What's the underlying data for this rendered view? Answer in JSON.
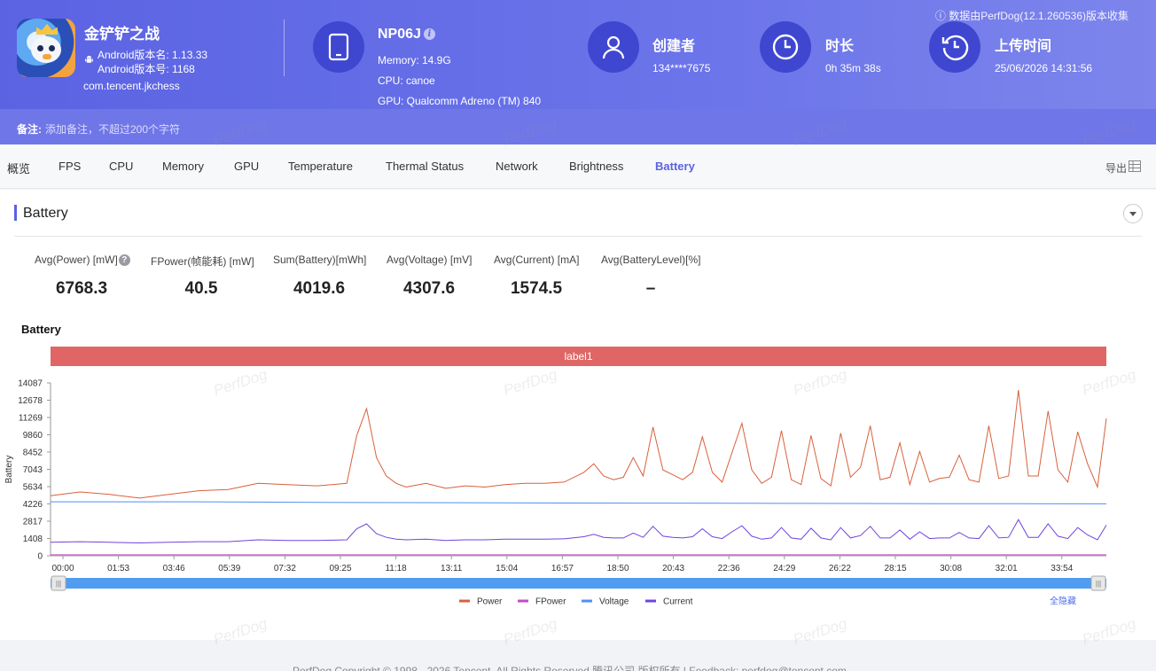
{
  "app": {
    "game_name": "金铲铲之战",
    "version_name": "Android版本名: 1.13.33",
    "version_code": "Android版本号: 1168",
    "package": "com.tencent.jkchess"
  },
  "device": {
    "name": "NP06J",
    "memory": "Memory: 14.9G",
    "cpu": "CPU: canoe",
    "gpu": "GPU: Qualcomm Adreno (TM) 840"
  },
  "creator": {
    "title": "创建者",
    "value": "134****7675"
  },
  "duration": {
    "title": "时长",
    "value": "0h 35m 38s"
  },
  "upload": {
    "title": "上传时间",
    "value": "25/06/2026 14:31:56"
  },
  "source_note": "数据由PerfDog(12.1.260536)版本收集",
  "notes": {
    "label": "备注:",
    "placeholder": "添加备注，不超过200个字符"
  },
  "tabs": [
    "概览",
    "FPS",
    "CPU",
    "Memory",
    "GPU",
    "Temperature",
    "Thermal Status",
    "Network",
    "Brightness",
    "Battery"
  ],
  "active_tab": "Battery",
  "export_label": "导出",
  "section_title": "Battery",
  "stats": [
    {
      "label": "Avg(Power) [mW]",
      "value": "6768.3"
    },
    {
      "label": "FPower(帧能耗) [mW]",
      "value": "40.5"
    },
    {
      "label": "Sum(Battery)[mWh]",
      "value": "4019.6"
    },
    {
      "label": "Avg(Voltage) [mV]",
      "value": "4307.6"
    },
    {
      "label": "Avg(Current) [mA]",
      "value": "1574.5"
    },
    {
      "label": "Avg(BatteryLevel)[%]",
      "value": "–"
    }
  ],
  "watermark_text": "PerfDog",
  "hide_all_label": "全隐藏",
  "footer_text": "PerfDog   Copyright © 1998 - 2026 Tencent. All Rights Reserved 腾讯公司 版权所有 | Feedback: perfdog@tencent.com",
  "chart_data": {
    "type": "line",
    "title": "Battery",
    "ylabel": "Battery",
    "label_bar": "label1",
    "x_ticks": [
      "00:00",
      "01:53",
      "03:46",
      "05:39",
      "07:32",
      "09:25",
      "11:18",
      "13:11",
      "15:04",
      "16:57",
      "18:50",
      "20:43",
      "22:36",
      "24:29",
      "26:22",
      "28:15",
      "30:08",
      "32:01",
      "33:54"
    ],
    "y_ticks": [
      0,
      1408,
      2817,
      4226,
      5634,
      7043,
      8452,
      9860,
      11269,
      12678,
      14087
    ],
    "x_range_seconds": [
      0,
      2138
    ],
    "ylim": [
      0,
      14087
    ],
    "legend_position": "bottom",
    "series": [
      {
        "name": "Power",
        "color": "#d9603b",
        "x": [
          0,
          60,
          120,
          180,
          240,
          300,
          360,
          420,
          480,
          540,
          600,
          620,
          640,
          660,
          680,
          700,
          720,
          760,
          800,
          840,
          880,
          920,
          960,
          1000,
          1040,
          1080,
          1100,
          1120,
          1140,
          1160,
          1180,
          1200,
          1220,
          1240,
          1260,
          1280,
          1300,
          1320,
          1340,
          1360,
          1380,
          1400,
          1420,
          1440,
          1460,
          1480,
          1500,
          1520,
          1540,
          1560,
          1580,
          1600,
          1620,
          1640,
          1660,
          1680,
          1700,
          1720,
          1740,
          1760,
          1780,
          1800,
          1820,
          1840,
          1860,
          1880,
          1900,
          1920,
          1940,
          1960,
          1980,
          2000,
          2020,
          2040,
          2060,
          2080,
          2100,
          2120,
          2138
        ],
        "values": [
          4900,
          5200,
          5000,
          4700,
          5000,
          5300,
          5400,
          5900,
          5800,
          5700,
          5900,
          9800,
          12000,
          8000,
          6500,
          5900,
          5600,
          5900,
          5500,
          5700,
          5600,
          5800,
          5900,
          5900,
          6000,
          6800,
          7500,
          6500,
          6200,
          6400,
          8000,
          6500,
          10500,
          7000,
          6600,
          6200,
          6800,
          9700,
          6800,
          6000,
          8400,
          10800,
          7000,
          5900,
          6400,
          10200,
          6200,
          5800,
          9800,
          6300,
          5700,
          10000,
          6400,
          7200,
          10600,
          6200,
          6400,
          9200,
          5800,
          8500,
          6000,
          6300,
          6400,
          8200,
          6200,
          6000,
          10600,
          6300,
          6500,
          13500,
          6500,
          6500,
          11800,
          7000,
          6000,
          10100,
          7500,
          5600,
          11200
        ]
      },
      {
        "name": "FPower",
        "color": "#c54bc6",
        "x": [
          0,
          2138
        ],
        "values": [
          80,
          80
        ]
      },
      {
        "name": "Voltage",
        "color": "#4f8ff0",
        "x": [
          0,
          300,
          600,
          900,
          1200,
          1500,
          1800,
          2138
        ],
        "values": [
          4400,
          4400,
          4340,
          4310,
          4290,
          4270,
          4250,
          4230
        ]
      },
      {
        "name": "Current",
        "color": "#6f43e0",
        "x": [
          0,
          60,
          120,
          180,
          240,
          300,
          360,
          420,
          480,
          540,
          600,
          620,
          640,
          660,
          680,
          700,
          720,
          760,
          800,
          840,
          880,
          920,
          960,
          1000,
          1040,
          1080,
          1100,
          1120,
          1140,
          1160,
          1180,
          1200,
          1220,
          1240,
          1260,
          1280,
          1300,
          1320,
          1340,
          1360,
          1380,
          1400,
          1420,
          1440,
          1460,
          1480,
          1500,
          1520,
          1540,
          1560,
          1580,
          1600,
          1620,
          1640,
          1660,
          1680,
          1700,
          1720,
          1740,
          1760,
          1780,
          1800,
          1820,
          1840,
          1860,
          1880,
          1900,
          1920,
          1940,
          1960,
          1980,
          2000,
          2020,
          2040,
          2060,
          2080,
          2100,
          2120,
          2138
        ],
        "values": [
          1100,
          1150,
          1100,
          1050,
          1100,
          1150,
          1150,
          1300,
          1250,
          1250,
          1300,
          2200,
          2600,
          1800,
          1500,
          1350,
          1300,
          1350,
          1250,
          1300,
          1300,
          1350,
          1350,
          1350,
          1380,
          1550,
          1750,
          1500,
          1450,
          1450,
          1850,
          1500,
          2400,
          1600,
          1500,
          1450,
          1550,
          2200,
          1550,
          1400,
          1950,
          2450,
          1600,
          1350,
          1450,
          2300,
          1450,
          1350,
          2250,
          1450,
          1300,
          2300,
          1450,
          1650,
          2400,
          1450,
          1450,
          2100,
          1350,
          1950,
          1400,
          1450,
          1450,
          1900,
          1450,
          1400,
          2450,
          1450,
          1500,
          2950,
          1500,
          1500,
          2600,
          1600,
          1400,
          2300,
          1700,
          1300,
          2500
        ]
      }
    ]
  }
}
